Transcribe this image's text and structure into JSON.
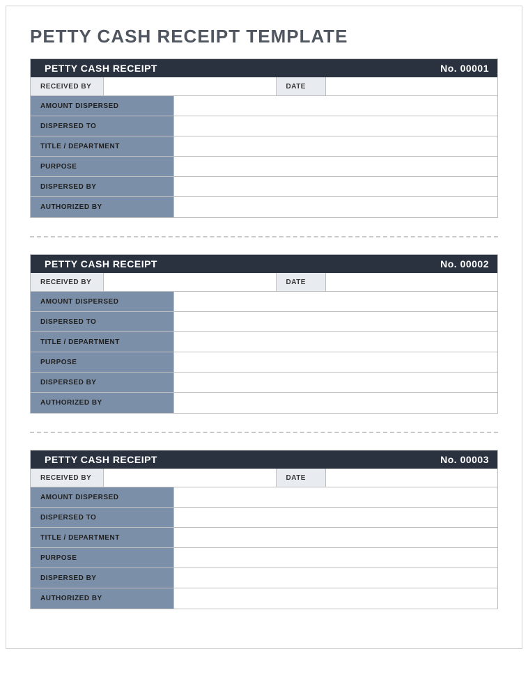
{
  "title": "PETTY CASH RECEIPT TEMPLATE",
  "receipts": [
    {
      "header_title": "PETTY CASH RECEIPT",
      "header_no": "No. 00001",
      "received_by_label": "RECEIVED BY",
      "received_by_value": "",
      "date_label": "DATE",
      "date_value": "",
      "fields": [
        {
          "label": "AMOUNT DISPERSED",
          "value": ""
        },
        {
          "label": "DISPERSED TO",
          "value": ""
        },
        {
          "label": "TITLE / DEPARTMENT",
          "value": ""
        },
        {
          "label": "PURPOSE",
          "value": ""
        },
        {
          "label": "DISPERSED BY",
          "value": ""
        },
        {
          "label": "AUTHORIZED BY",
          "value": ""
        }
      ]
    },
    {
      "header_title": "PETTY CASH RECEIPT",
      "header_no": "No. 00002",
      "received_by_label": "RECEIVED BY",
      "received_by_value": "",
      "date_label": "DATE",
      "date_value": "",
      "fields": [
        {
          "label": "AMOUNT DISPERSED",
          "value": ""
        },
        {
          "label": "DISPERSED TO",
          "value": ""
        },
        {
          "label": "TITLE / DEPARTMENT",
          "value": ""
        },
        {
          "label": "PURPOSE",
          "value": ""
        },
        {
          "label": "DISPERSED BY",
          "value": ""
        },
        {
          "label": "AUTHORIZED BY",
          "value": ""
        }
      ]
    },
    {
      "header_title": "PETTY CASH RECEIPT",
      "header_no": "No. 00003",
      "received_by_label": "RECEIVED BY",
      "received_by_value": "",
      "date_label": "DATE",
      "date_value": "",
      "fields": [
        {
          "label": "AMOUNT DISPERSED",
          "value": ""
        },
        {
          "label": "DISPERSED TO",
          "value": ""
        },
        {
          "label": "TITLE / DEPARTMENT",
          "value": ""
        },
        {
          "label": "PURPOSE",
          "value": ""
        },
        {
          "label": "DISPERSED BY",
          "value": ""
        },
        {
          "label": "AUTHORIZED BY",
          "value": ""
        }
      ]
    }
  ]
}
